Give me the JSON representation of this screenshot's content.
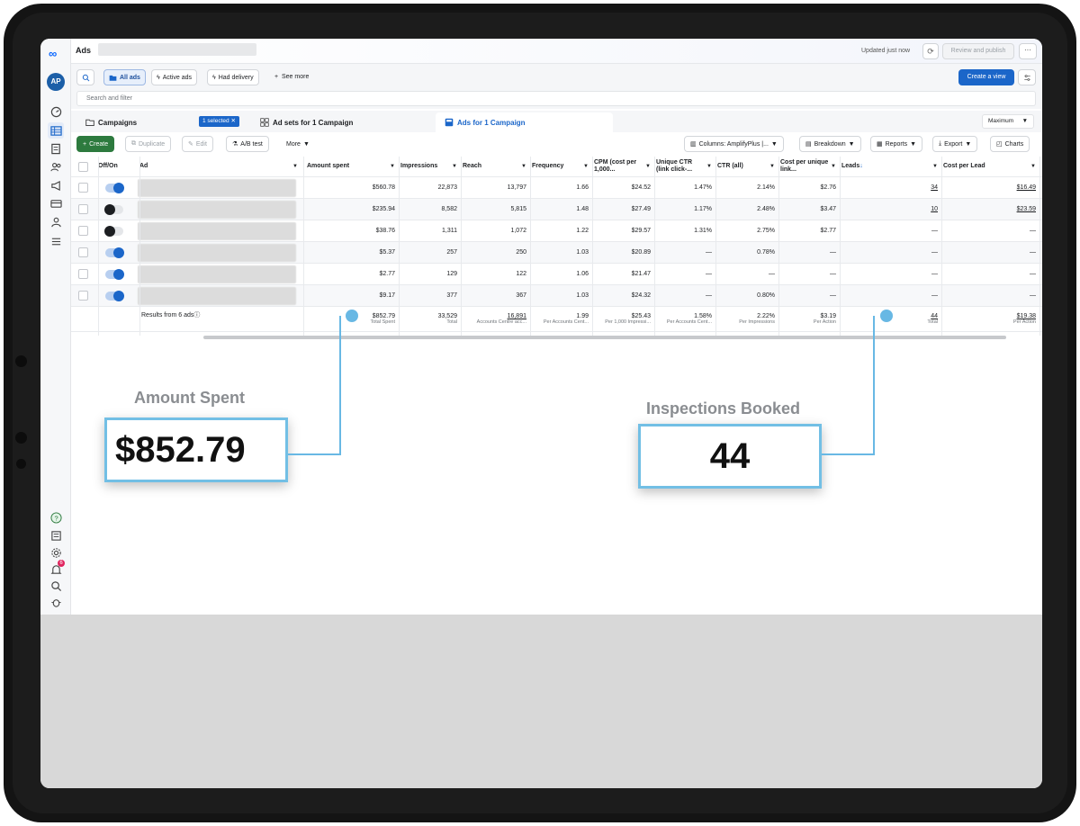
{
  "app": {
    "title": "Ads"
  },
  "topbar": {
    "updated": "Updated just now",
    "review_label": "Review and publish",
    "more_label": "···"
  },
  "filters": {
    "all_ads": "All ads",
    "active_ads": "Active ads",
    "had_delivery": "Had delivery",
    "see_more": "See more",
    "create_view": "Create a view",
    "search_placeholder": "Search and filter"
  },
  "tabs": {
    "campaigns": "Campaigns",
    "selected_badge": "1 selected",
    "adsets": "Ad sets for 1 Campaign",
    "ads": "Ads for 1 Campaign",
    "attribution": "Maximum"
  },
  "toolbar": {
    "create": "Create",
    "duplicate": "Duplicate",
    "edit": "Edit",
    "ab_test": "A/B test",
    "more": "More",
    "columns": "Columns: AmplifyPlus |...",
    "breakdown": "Breakdown",
    "reports": "Reports",
    "export": "Export",
    "charts": "Charts"
  },
  "table": {
    "headers": {
      "offon": "Off/On",
      "ad": "Ad",
      "amount": "Amount spent",
      "impressions": "Impressions",
      "reach": "Reach",
      "frequency": "Frequency",
      "cpm": "CPM (cost per 1,000...",
      "uctr": "Unique CTR (link click-...",
      "ctr": "CTR (all)",
      "cpu": "Cost per unique link...",
      "leads": "Leads",
      "cpl": "Cost per Lead"
    },
    "rows": [
      {
        "on": true,
        "amount": "$560.78",
        "impressions": "22,873",
        "reach": "13,797",
        "frequency": "1.66",
        "cpm": "$24.52",
        "uctr": "1.47%",
        "ctr": "2.14%",
        "cpu": "$2.76",
        "leads": "34",
        "cpl": "$16.49"
      },
      {
        "on": false,
        "amount": "$235.94",
        "impressions": "8,582",
        "reach": "5,815",
        "frequency": "1.48",
        "cpm": "$27.49",
        "uctr": "1.17%",
        "ctr": "2.48%",
        "cpu": "$3.47",
        "leads": "10",
        "cpl": "$23.59"
      },
      {
        "on": false,
        "amount": "$38.76",
        "impressions": "1,311",
        "reach": "1,072",
        "frequency": "1.22",
        "cpm": "$29.57",
        "uctr": "1.31%",
        "ctr": "2.75%",
        "cpu": "$2.77",
        "leads": "—",
        "cpl": "—"
      },
      {
        "on": true,
        "amount": "$5.37",
        "impressions": "257",
        "reach": "250",
        "frequency": "1.03",
        "cpm": "$20.89",
        "uctr": "—",
        "ctr": "0.78%",
        "cpu": "—",
        "leads": "—",
        "cpl": "—"
      },
      {
        "on": true,
        "amount": "$2.77",
        "impressions": "129",
        "reach": "122",
        "frequency": "1.06",
        "cpm": "$21.47",
        "uctr": "—",
        "ctr": "—",
        "cpu": "—",
        "leads": "—",
        "cpl": "—"
      },
      {
        "on": true,
        "amount": "$9.17",
        "impressions": "377",
        "reach": "367",
        "frequency": "1.03",
        "cpm": "$24.32",
        "uctr": "—",
        "ctr": "0.80%",
        "cpu": "—",
        "leads": "—",
        "cpl": "—"
      }
    ],
    "totals": {
      "label": "Results from 6 ads",
      "amount": "$852.79",
      "amount_sub": "Total Spent",
      "impressions": "33,529",
      "impressions_sub": "Total",
      "reach": "16,891",
      "reach_sub": "Accounts Centre acc...",
      "frequency": "1.99",
      "frequency_sub": "Per Accounts Cent...",
      "cpm": "$25.43",
      "cpm_sub": "Per 1,000 Impressi...",
      "uctr": "1.58%",
      "uctr_sub": "Per Accounts Cent...",
      "ctr": "2.22%",
      "ctr_sub": "Per Impressions",
      "cpu": "$3.19",
      "cpu_sub": "Per Action",
      "leads": "44",
      "leads_sub": "Total",
      "cpl": "$19.38",
      "cpl_sub": "Per Action"
    }
  },
  "annotations": {
    "left_title": "Amount Spent",
    "left_value": "$852.79",
    "right_title": "Inspections Booked",
    "right_value": "44"
  },
  "colors": {
    "accent": "#1b66c9",
    "callout": "#68b8e4",
    "create": "#2d7a3e"
  }
}
